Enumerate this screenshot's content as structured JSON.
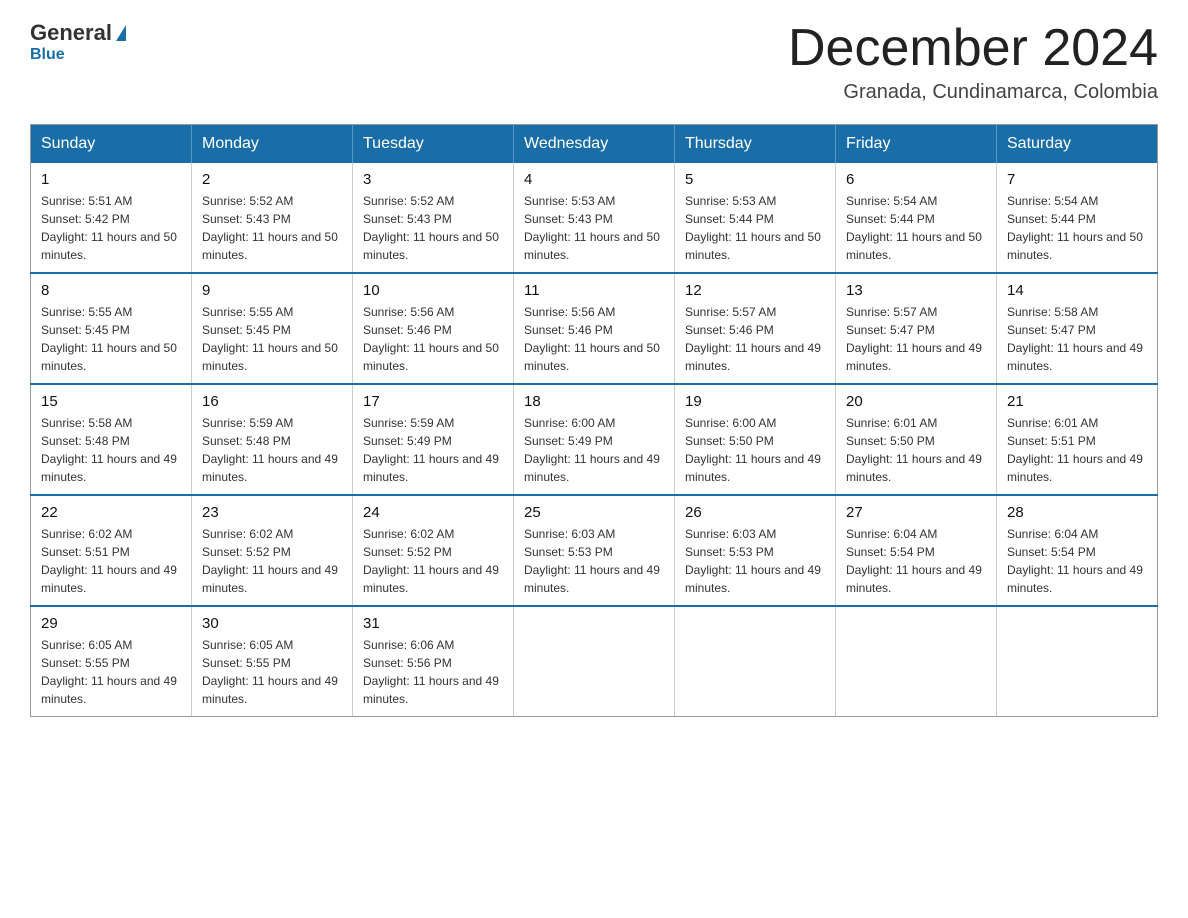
{
  "logo": {
    "text1": "General",
    "text2": "Blue"
  },
  "header": {
    "title": "December 2024",
    "location": "Granada, Cundinamarca, Colombia"
  },
  "weekdays": [
    "Sunday",
    "Monday",
    "Tuesday",
    "Wednesday",
    "Thursday",
    "Friday",
    "Saturday"
  ],
  "weeks": [
    [
      {
        "day": "1",
        "sunrise": "Sunrise: 5:51 AM",
        "sunset": "Sunset: 5:42 PM",
        "daylight": "Daylight: 11 hours and 50 minutes."
      },
      {
        "day": "2",
        "sunrise": "Sunrise: 5:52 AM",
        "sunset": "Sunset: 5:43 PM",
        "daylight": "Daylight: 11 hours and 50 minutes."
      },
      {
        "day": "3",
        "sunrise": "Sunrise: 5:52 AM",
        "sunset": "Sunset: 5:43 PM",
        "daylight": "Daylight: 11 hours and 50 minutes."
      },
      {
        "day": "4",
        "sunrise": "Sunrise: 5:53 AM",
        "sunset": "Sunset: 5:43 PM",
        "daylight": "Daylight: 11 hours and 50 minutes."
      },
      {
        "day": "5",
        "sunrise": "Sunrise: 5:53 AM",
        "sunset": "Sunset: 5:44 PM",
        "daylight": "Daylight: 11 hours and 50 minutes."
      },
      {
        "day": "6",
        "sunrise": "Sunrise: 5:54 AM",
        "sunset": "Sunset: 5:44 PM",
        "daylight": "Daylight: 11 hours and 50 minutes."
      },
      {
        "day": "7",
        "sunrise": "Sunrise: 5:54 AM",
        "sunset": "Sunset: 5:44 PM",
        "daylight": "Daylight: 11 hours and 50 minutes."
      }
    ],
    [
      {
        "day": "8",
        "sunrise": "Sunrise: 5:55 AM",
        "sunset": "Sunset: 5:45 PM",
        "daylight": "Daylight: 11 hours and 50 minutes."
      },
      {
        "day": "9",
        "sunrise": "Sunrise: 5:55 AM",
        "sunset": "Sunset: 5:45 PM",
        "daylight": "Daylight: 11 hours and 50 minutes."
      },
      {
        "day": "10",
        "sunrise": "Sunrise: 5:56 AM",
        "sunset": "Sunset: 5:46 PM",
        "daylight": "Daylight: 11 hours and 50 minutes."
      },
      {
        "day": "11",
        "sunrise": "Sunrise: 5:56 AM",
        "sunset": "Sunset: 5:46 PM",
        "daylight": "Daylight: 11 hours and 50 minutes."
      },
      {
        "day": "12",
        "sunrise": "Sunrise: 5:57 AM",
        "sunset": "Sunset: 5:46 PM",
        "daylight": "Daylight: 11 hours and 49 minutes."
      },
      {
        "day": "13",
        "sunrise": "Sunrise: 5:57 AM",
        "sunset": "Sunset: 5:47 PM",
        "daylight": "Daylight: 11 hours and 49 minutes."
      },
      {
        "day": "14",
        "sunrise": "Sunrise: 5:58 AM",
        "sunset": "Sunset: 5:47 PM",
        "daylight": "Daylight: 11 hours and 49 minutes."
      }
    ],
    [
      {
        "day": "15",
        "sunrise": "Sunrise: 5:58 AM",
        "sunset": "Sunset: 5:48 PM",
        "daylight": "Daylight: 11 hours and 49 minutes."
      },
      {
        "day": "16",
        "sunrise": "Sunrise: 5:59 AM",
        "sunset": "Sunset: 5:48 PM",
        "daylight": "Daylight: 11 hours and 49 minutes."
      },
      {
        "day": "17",
        "sunrise": "Sunrise: 5:59 AM",
        "sunset": "Sunset: 5:49 PM",
        "daylight": "Daylight: 11 hours and 49 minutes."
      },
      {
        "day": "18",
        "sunrise": "Sunrise: 6:00 AM",
        "sunset": "Sunset: 5:49 PM",
        "daylight": "Daylight: 11 hours and 49 minutes."
      },
      {
        "day": "19",
        "sunrise": "Sunrise: 6:00 AM",
        "sunset": "Sunset: 5:50 PM",
        "daylight": "Daylight: 11 hours and 49 minutes."
      },
      {
        "day": "20",
        "sunrise": "Sunrise: 6:01 AM",
        "sunset": "Sunset: 5:50 PM",
        "daylight": "Daylight: 11 hours and 49 minutes."
      },
      {
        "day": "21",
        "sunrise": "Sunrise: 6:01 AM",
        "sunset": "Sunset: 5:51 PM",
        "daylight": "Daylight: 11 hours and 49 minutes."
      }
    ],
    [
      {
        "day": "22",
        "sunrise": "Sunrise: 6:02 AM",
        "sunset": "Sunset: 5:51 PM",
        "daylight": "Daylight: 11 hours and 49 minutes."
      },
      {
        "day": "23",
        "sunrise": "Sunrise: 6:02 AM",
        "sunset": "Sunset: 5:52 PM",
        "daylight": "Daylight: 11 hours and 49 minutes."
      },
      {
        "day": "24",
        "sunrise": "Sunrise: 6:02 AM",
        "sunset": "Sunset: 5:52 PM",
        "daylight": "Daylight: 11 hours and 49 minutes."
      },
      {
        "day": "25",
        "sunrise": "Sunrise: 6:03 AM",
        "sunset": "Sunset: 5:53 PM",
        "daylight": "Daylight: 11 hours and 49 minutes."
      },
      {
        "day": "26",
        "sunrise": "Sunrise: 6:03 AM",
        "sunset": "Sunset: 5:53 PM",
        "daylight": "Daylight: 11 hours and 49 minutes."
      },
      {
        "day": "27",
        "sunrise": "Sunrise: 6:04 AM",
        "sunset": "Sunset: 5:54 PM",
        "daylight": "Daylight: 11 hours and 49 minutes."
      },
      {
        "day": "28",
        "sunrise": "Sunrise: 6:04 AM",
        "sunset": "Sunset: 5:54 PM",
        "daylight": "Daylight: 11 hours and 49 minutes."
      }
    ],
    [
      {
        "day": "29",
        "sunrise": "Sunrise: 6:05 AM",
        "sunset": "Sunset: 5:55 PM",
        "daylight": "Daylight: 11 hours and 49 minutes."
      },
      {
        "day": "30",
        "sunrise": "Sunrise: 6:05 AM",
        "sunset": "Sunset: 5:55 PM",
        "daylight": "Daylight: 11 hours and 49 minutes."
      },
      {
        "day": "31",
        "sunrise": "Sunrise: 6:06 AM",
        "sunset": "Sunset: 5:56 PM",
        "daylight": "Daylight: 11 hours and 49 minutes."
      },
      null,
      null,
      null,
      null
    ]
  ]
}
